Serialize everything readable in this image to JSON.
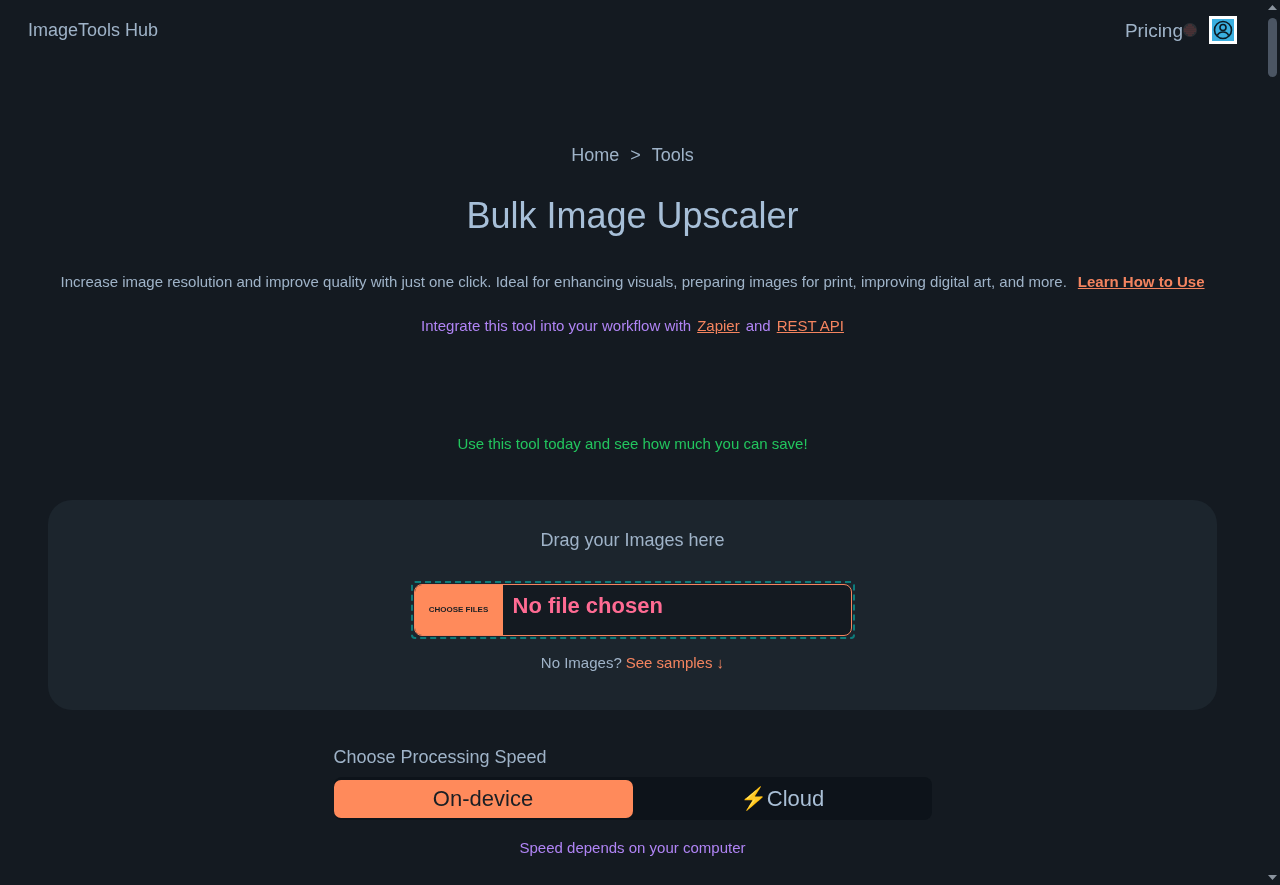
{
  "header": {
    "brand": "ImageTools Hub",
    "nav": [
      {
        "label": "Pricing"
      }
    ]
  },
  "breadcrumb": {
    "items": [
      {
        "label": "Home"
      },
      {
        "label": "Tools"
      }
    ],
    "separator": ">"
  },
  "title": "Bulk Image Upscaler",
  "description": {
    "text": "Increase image resolution and improve quality with just one click. Ideal for enhancing visuals, preparing images for print, improving digital art, and more.",
    "link": "Learn How to Use"
  },
  "integration": {
    "text": "Integrate this tool into your workflow with",
    "links": [
      "Zapier",
      "REST API"
    ],
    "joiner": "and"
  },
  "promo": "Use this tool today and see how much you can save!",
  "upload": {
    "heading": "Drag your Images here",
    "button": "CHOOSE FILES",
    "status": "No file chosen",
    "samples_prompt": "No Images?",
    "samples_link": "See samples ↓"
  },
  "speed": {
    "label": "Choose Processing Speed",
    "options": [
      {
        "label": "On-device",
        "selected": true
      },
      {
        "label": "⚡Cloud",
        "selected": false
      }
    ],
    "note": "Speed depends on your computer"
  }
}
